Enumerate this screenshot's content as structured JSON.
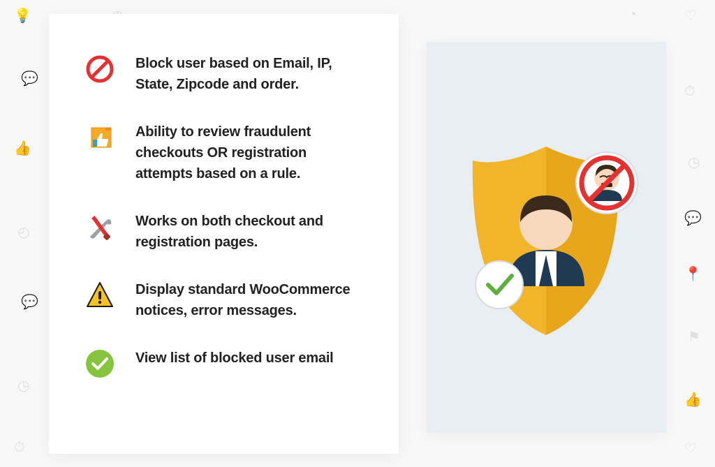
{
  "features": [
    {
      "icon": "block",
      "text": "Block user based on Email, IP, State, Zipcode and order."
    },
    {
      "icon": "thumb",
      "text": "Ability to review fraudulent checkouts OR registration attempts based on a rule."
    },
    {
      "icon": "tools",
      "text": "Works on both checkout and registration pages."
    },
    {
      "icon": "warn",
      "text": "Display standard WooCommerce notices, error messages."
    },
    {
      "icon": "check",
      "text": "View list of blocked user email"
    }
  ]
}
